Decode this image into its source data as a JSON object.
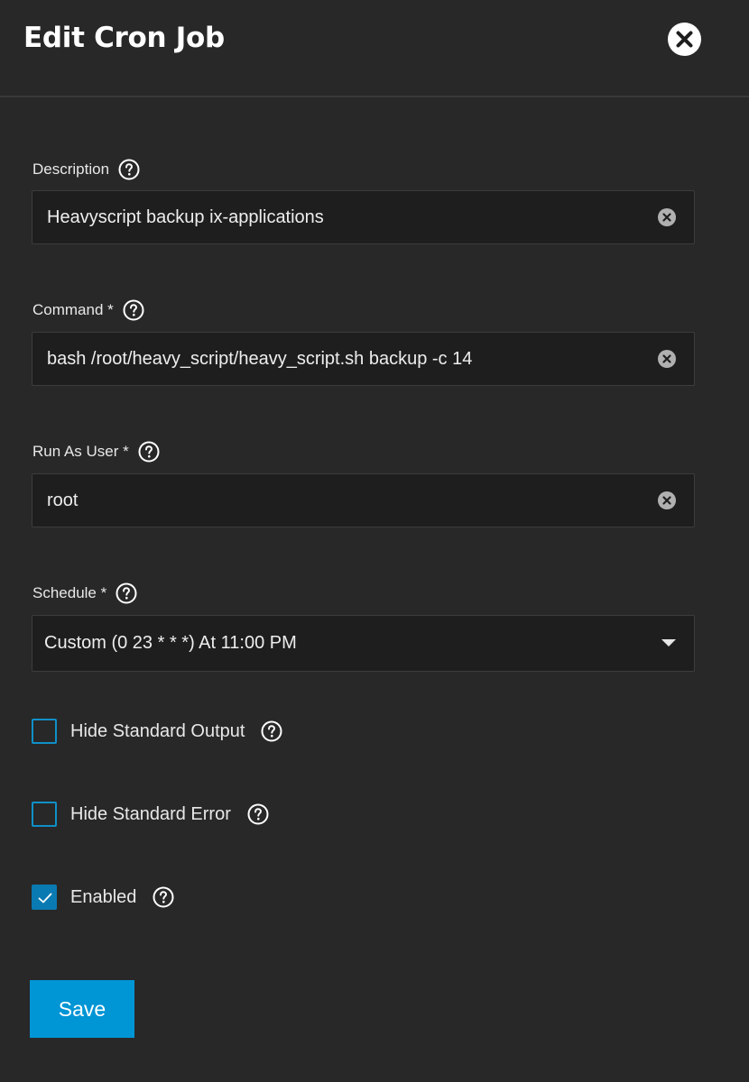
{
  "dialog": {
    "title": "Edit Cron Job",
    "close_icon": "close-icon"
  },
  "fields": {
    "description": {
      "label": "Description",
      "value": "Heavyscript backup ix-applications"
    },
    "command": {
      "label": "Command *",
      "value": "bash /root/heavy_script/heavy_script.sh backup -c 14"
    },
    "user": {
      "label": "Run As User *",
      "value": "root"
    },
    "schedule": {
      "label": "Schedule *",
      "value": "Custom (0 23 * * *) At 11:00 PM"
    }
  },
  "checkboxes": {
    "hide_stdout": {
      "label": "Hide Standard Output",
      "checked": false
    },
    "hide_stderr": {
      "label": "Hide Standard Error",
      "checked": false
    },
    "enabled": {
      "label": "Enabled",
      "checked": true
    }
  },
  "actions": {
    "save_label": "Save"
  },
  "colors": {
    "background": "#282828",
    "input_background": "#1e1e1e",
    "accent": "#0095d5",
    "checkbox_border": "#0f90c8"
  },
  "icons": {
    "help": "help-circle-icon",
    "clear": "clear-circle-icon",
    "dropdown": "triangle-down-icon",
    "check": "check-icon"
  }
}
